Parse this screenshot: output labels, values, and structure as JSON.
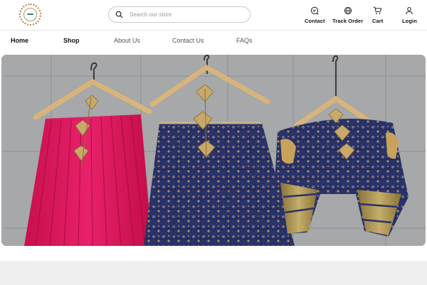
{
  "header": {
    "search": {
      "placeholder": "Search our store"
    },
    "actions": [
      {
        "label": "Contact",
        "icon": "chat-icon"
      },
      {
        "label": "Track Order",
        "icon": "globe-icon"
      },
      {
        "label": "Cart",
        "icon": "cart-icon"
      },
      {
        "label": "Login",
        "icon": "user-icon"
      }
    ]
  },
  "nav": {
    "items": [
      {
        "label": "Home",
        "bold": true
      },
      {
        "label": "Shop",
        "bold": true
      },
      {
        "label": "About Us",
        "bold": false
      },
      {
        "label": "Contact Us",
        "bold": false
      },
      {
        "label": "FAQs",
        "bold": false
      }
    ]
  },
  "hero": {
    "image": "three ethnic garments on wooden hangers: pink pleated lehenga, navy printed lehenga, navy and gold blouse",
    "colors": {
      "pink": "#e0165a",
      "navy": "#243063",
      "gold": "#b89a52",
      "wall": "#a9a9a9"
    }
  }
}
